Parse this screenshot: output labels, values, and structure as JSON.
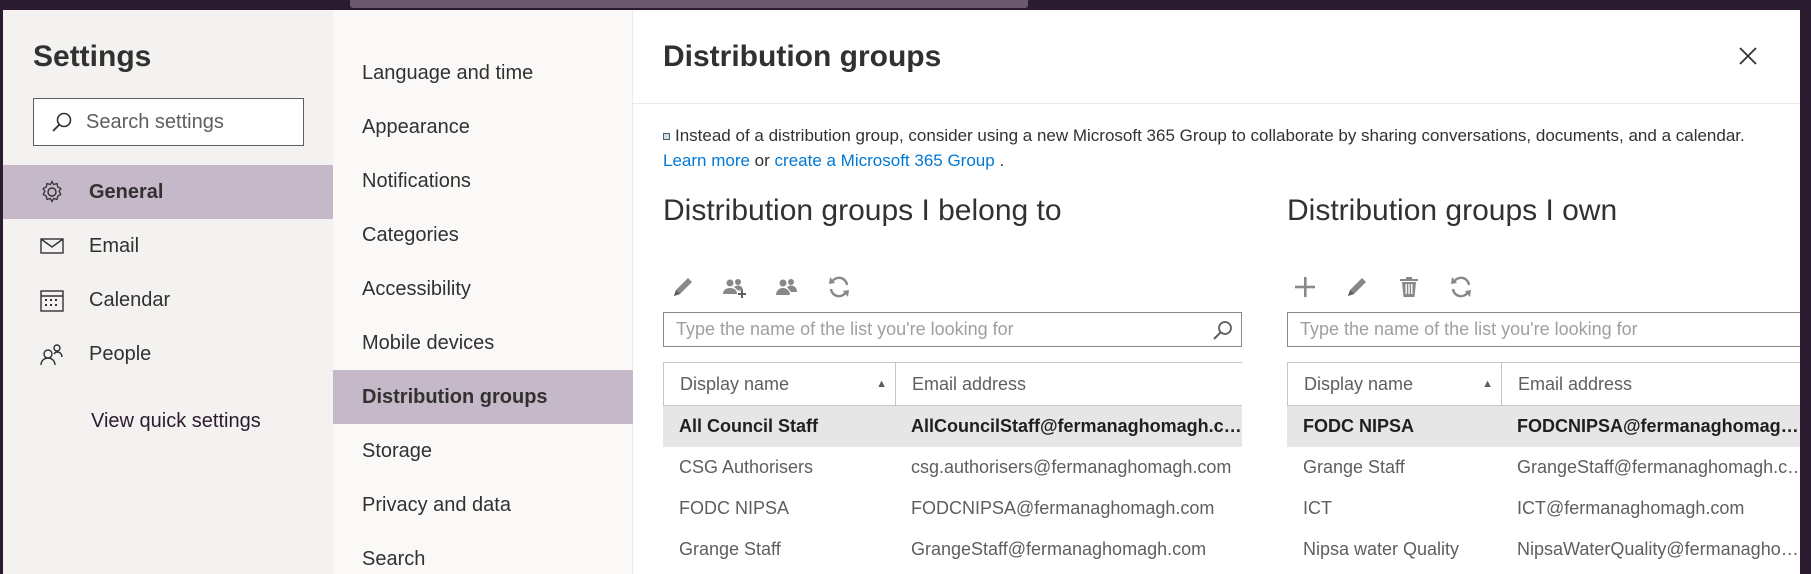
{
  "settings": {
    "title": "Settings",
    "search_placeholder": "Search settings",
    "nav": [
      {
        "label": "General",
        "icon": "gear-icon"
      },
      {
        "label": "Email",
        "icon": "mail-icon"
      },
      {
        "label": "Calendar",
        "icon": "calendar-icon"
      },
      {
        "label": "People",
        "icon": "people-icon"
      }
    ],
    "quick_settings": "View quick settings"
  },
  "subnav": [
    "Language and time",
    "Appearance",
    "Notifications",
    "Categories",
    "Accessibility",
    "Mobile devices",
    "Distribution groups",
    "Storage",
    "Privacy and data",
    "Search"
  ],
  "page": {
    "title": "Distribution groups",
    "info_text": "Instead of a distribution group, consider using a new Microsoft 365 Group to collaborate by sharing conversations, documents, and a calendar.",
    "learn_more": "Learn more",
    "or_text": "or",
    "create_link": "create a Microsoft 365 Group",
    "period": "."
  },
  "belong": {
    "title": "Distribution groups I belong to",
    "toolbar": [
      "pencil-icon",
      "add-members-icon",
      "members-icon",
      "refresh-icon"
    ],
    "search_placeholder": "Type the name of the list you're looking for",
    "col_name": "Display name",
    "col_email": "Email address",
    "rows": [
      {
        "name": "All Council Staff",
        "email": "AllCouncilStaff@fermanaghomagh.com"
      },
      {
        "name": "CSG Authorisers",
        "email": "csg.authorisers@fermanaghomagh.com"
      },
      {
        "name": "FODC NIPSA",
        "email": "FODCNIPSA@fermanaghomagh.com"
      },
      {
        "name": "Grange Staff",
        "email": "GrangeStaff@fermanaghomagh.com"
      }
    ]
  },
  "own": {
    "title": "Distribution groups I own",
    "toolbar": [
      "plus-icon",
      "pencil-icon",
      "trash-icon",
      "refresh-icon"
    ],
    "search_placeholder": "Type the name of the list you're looking for",
    "col_name": "Display name",
    "col_email": "Email address",
    "rows": [
      {
        "name": "FODC NIPSA",
        "email": "FODCNIPSA@fermanaghomagh.c..."
      },
      {
        "name": "Grange Staff",
        "email": "GrangeStaff@fermanaghomagh.com"
      },
      {
        "name": "ICT",
        "email": "ICT@fermanaghomagh.com"
      },
      {
        "name": "Nipsa water Quality",
        "email": "NipsaWaterQuality@fermanaghom..."
      }
    ]
  }
}
